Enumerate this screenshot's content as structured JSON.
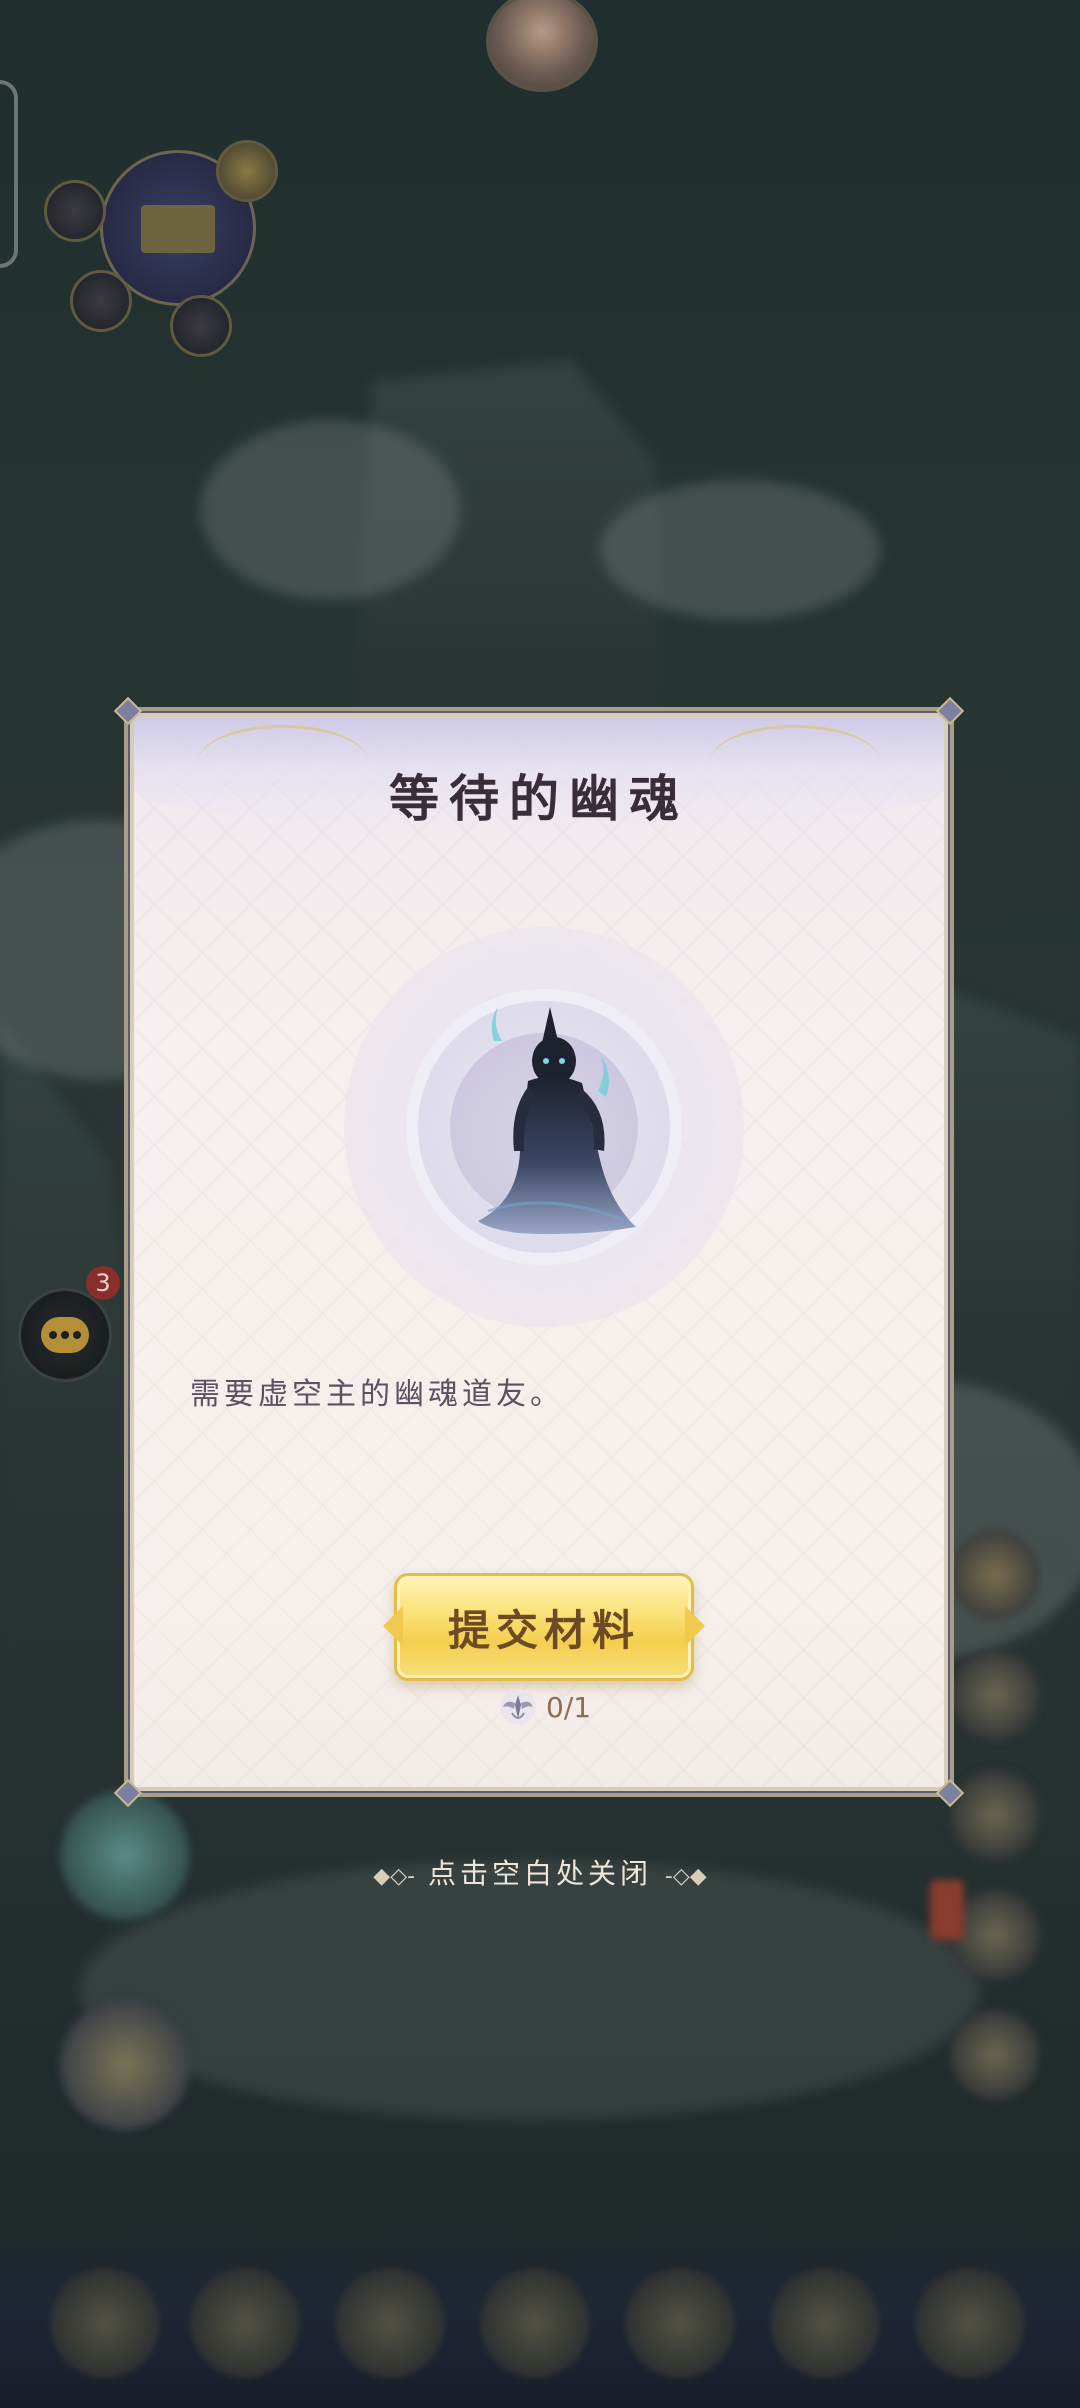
{
  "dialog": {
    "title": "等待的幽魂",
    "description": "需要虚空主的幽魂道友。",
    "submit_label": "提交材料",
    "material_progress": "0/1"
  },
  "chat": {
    "badge_count": "3"
  },
  "close_hint": {
    "text": "点击空白处关闭",
    "left_deco": "◆◇-",
    "right_deco": "-◇◆"
  },
  "icons": {
    "portrait": "ghost-figure-icon",
    "material": "winged-emblem-icon",
    "chat": "chat-bubble-icon"
  },
  "colors": {
    "button_gold": "#f4cf4f",
    "title_text": "#3a2d3a",
    "badge_red": "#8a2e2c"
  }
}
